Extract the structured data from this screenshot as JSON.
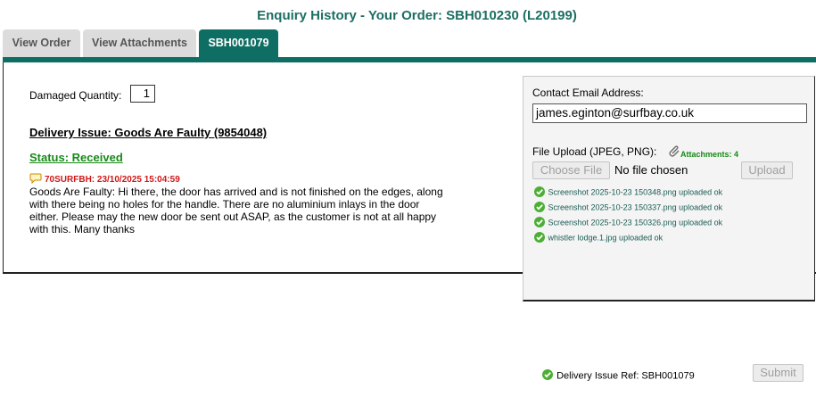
{
  "page": {
    "title": "Enquiry History - Your Order: SBH010230 (L20199)"
  },
  "tabs": [
    {
      "label": "View Order"
    },
    {
      "label": "View Attachments"
    },
    {
      "label": "SBH001079"
    }
  ],
  "issue": {
    "damaged_quantity_label": "Damaged Quantity:",
    "damaged_quantity_value": "1",
    "title": "Delivery Issue: Goods Are Faulty (9854048)",
    "status": "Status: Received",
    "comment_meta": "70SURFBH: 23/10/2025 15:04:59",
    "comment_text": "Goods Are Faulty: Hi there, the door has arrived and is not finished on the edges, along with there being no holes for the handle. There are no aluminium inlays in the door either. Please may the new door be sent out ASAP, as the customer is not at all happy with this. Many thanks"
  },
  "contact": {
    "email_label": "Contact Email Address:",
    "email_value": "james.eginton@surfbay.co.uk"
  },
  "upload": {
    "label": "File Upload (JPEG, PNG):",
    "attachments_label": "Attachments: 4",
    "choose_file_label": "Choose File",
    "no_file_text": "No file chosen",
    "upload_button_label": "Upload",
    "uploaded": [
      "Screenshot 2025-10-23 150348.png uploaded ok",
      "Screenshot 2025-10-23 150337.png uploaded ok",
      "Screenshot 2025-10-23 150326.png uploaded ok",
      "whistler lodge.1.jpg uploaded ok"
    ]
  },
  "footer": {
    "delivery_ref": "Delivery Issue Ref: SBH001079",
    "submit_label": "Submit"
  },
  "colors": {
    "teal": "#0f6e63",
    "status_green": "#178a17",
    "meta_red": "#d01818"
  }
}
